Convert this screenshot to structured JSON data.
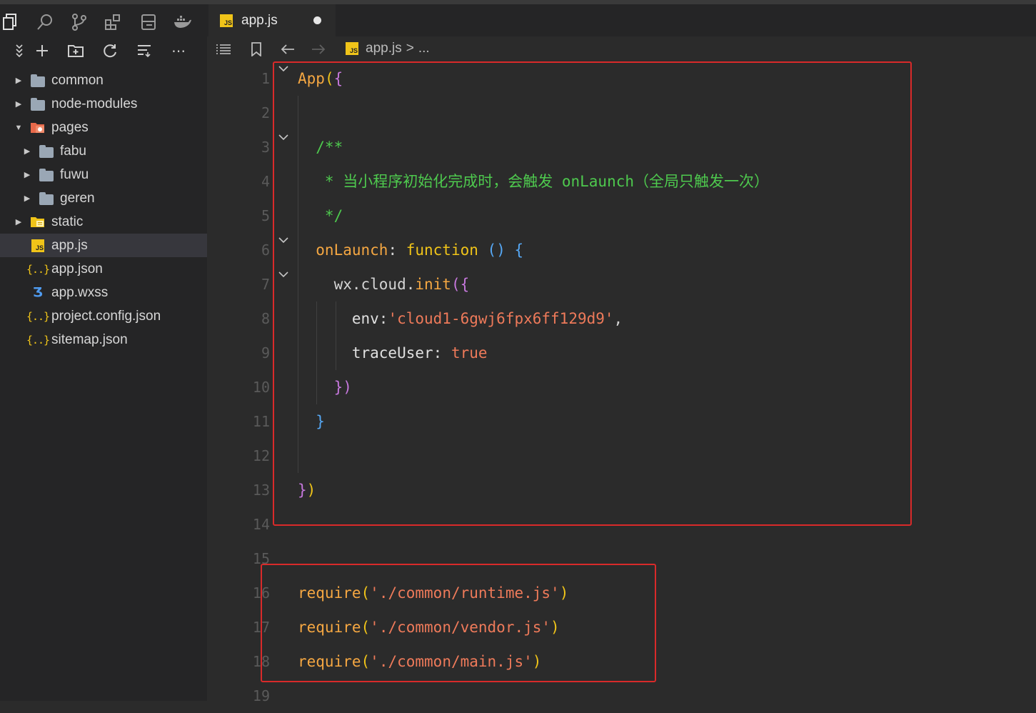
{
  "activity_bar": {
    "icons": [
      "files-icon",
      "search-icon",
      "source-control-icon",
      "extensions-icon",
      "outline-icon",
      "docker-icon"
    ]
  },
  "explorer_toolbar": {
    "icons": [
      "collapse-icon",
      "new-file-icon",
      "new-folder-icon",
      "refresh-icon",
      "sort-icon",
      "more-icon"
    ]
  },
  "file_tree": {
    "items": [
      {
        "label": "common",
        "type": "folder",
        "depth": 0,
        "expanded": false
      },
      {
        "label": "node-modules",
        "type": "folder",
        "depth": 0,
        "expanded": false
      },
      {
        "label": "pages",
        "type": "folder-special",
        "depth": 0,
        "expanded": true
      },
      {
        "label": "fabu",
        "type": "folder",
        "depth": 1,
        "expanded": false
      },
      {
        "label": "fuwu",
        "type": "folder",
        "depth": 1,
        "expanded": false
      },
      {
        "label": "geren",
        "type": "folder",
        "depth": 1,
        "expanded": false
      },
      {
        "label": "static",
        "type": "folder-static",
        "depth": 0,
        "expanded": false
      },
      {
        "label": "app.js",
        "type": "js",
        "depth": 0,
        "selected": true
      },
      {
        "label": "app.json",
        "type": "json",
        "depth": 0
      },
      {
        "label": "app.wxss",
        "type": "wxss",
        "depth": 0
      },
      {
        "label": "project.config.json",
        "type": "json",
        "depth": 0
      },
      {
        "label": "sitemap.json",
        "type": "json",
        "depth": 0
      }
    ]
  },
  "tab": {
    "title": "app.js",
    "badge": "JS",
    "modified": true
  },
  "breadcrumb": {
    "file": "app.js",
    "separator": ">",
    "rest": "..."
  },
  "editor": {
    "line_numbers": [
      "1",
      "2",
      "3",
      "4",
      "5",
      "6",
      "7",
      "8",
      "9",
      "10",
      "11",
      "12",
      "13",
      "14",
      "15",
      "16",
      "17",
      "18",
      "19"
    ],
    "lines": {
      "l1": [
        {
          "c": "k-id",
          "t": "App"
        },
        {
          "c": "k-punc",
          "t": "("
        },
        {
          "c": "k-brace",
          "t": "{"
        }
      ],
      "l3": [
        {
          "c": "k-com",
          "t": "  /**"
        }
      ],
      "l4": [
        {
          "c": "k-com",
          "t": "   * 当小程序初始化完成时，会触发 onLaunch（全局只触发一次）"
        }
      ],
      "l5": [
        {
          "c": "k-com",
          "t": "   */"
        }
      ],
      "l6": [
        {
          "c": "k-fn",
          "t": "  onLaunch"
        },
        {
          "c": "k-plain",
          "t": ": "
        },
        {
          "c": "k-punc",
          "t": "function"
        },
        {
          "c": "k-plain",
          "t": " "
        },
        {
          "c": "k-blue",
          "t": "()"
        },
        {
          "c": "k-plain",
          "t": " "
        },
        {
          "c": "k-blue",
          "t": "{"
        }
      ],
      "l7": [
        {
          "c": "k-plain",
          "t": "    wx.cloud."
        },
        {
          "c": "k-fn",
          "t": "init"
        },
        {
          "c": "k-brace",
          "t": "({"
        }
      ],
      "l8": [
        {
          "c": "k-prop",
          "t": "      env"
        },
        {
          "c": "k-plain",
          "t": ":"
        },
        {
          "c": "k-str",
          "t": "'cloud1-6gwj6fpx6ff129d9'"
        },
        {
          "c": "k-plain",
          "t": ","
        }
      ],
      "l9": [
        {
          "c": "k-prop",
          "t": "      traceUser"
        },
        {
          "c": "k-plain",
          "t": ": "
        },
        {
          "c": "k-true",
          "t": "true"
        }
      ],
      "l10": [
        {
          "c": "k-brace",
          "t": "    })"
        }
      ],
      "l11": [
        {
          "c": "k-blue",
          "t": "  }"
        }
      ],
      "l13": [
        {
          "c": "k-brace",
          "t": "}"
        },
        {
          "c": "k-punc",
          "t": ")"
        }
      ],
      "l16": [
        {
          "c": "k-id",
          "t": "require"
        },
        {
          "c": "k-punc",
          "t": "("
        },
        {
          "c": "k-str",
          "t": "'./common/runtime.js'"
        },
        {
          "c": "k-punc",
          "t": ")"
        }
      ],
      "l17": [
        {
          "c": "k-id",
          "t": "require"
        },
        {
          "c": "k-punc",
          "t": "("
        },
        {
          "c": "k-str",
          "t": "'./common/vendor.js'"
        },
        {
          "c": "k-punc",
          "t": ")"
        }
      ],
      "l18": [
        {
          "c": "k-id",
          "t": "require"
        },
        {
          "c": "k-punc",
          "t": "("
        },
        {
          "c": "k-str",
          "t": "'./common/main.js'"
        },
        {
          "c": "k-punc",
          "t": ")"
        }
      ]
    },
    "folded_lines": [
      "1",
      "3",
      "6",
      "7"
    ]
  },
  "highlight_color": "#d92a2a"
}
